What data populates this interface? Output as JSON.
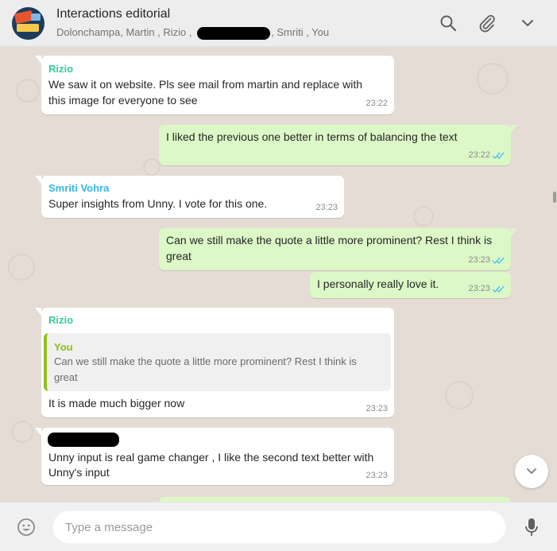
{
  "header": {
    "title": "Interactions editorial",
    "members_before": "Dolonchampa, Martin , Rizio ,",
    "members_after": ", Smriti , You",
    "icons": [
      "search-icon",
      "attach-icon",
      "chevron-down-icon"
    ]
  },
  "messages": [
    {
      "sender": "Rizio",
      "lines": [
        "We saw it on website. Pls see mail from martin and replace with",
        "this image for everyone to see"
      ],
      "time": "23:22"
    },
    {
      "lines": [
        "I liked the previous one better in terms of balancing the text"
      ],
      "time": "23:22"
    },
    {
      "sender": "Smriti Vohra",
      "lines": [
        "Super insights from Unny. I vote for this one."
      ],
      "time": "23:23"
    },
    {
      "lines": [
        "Can we still make the quote a little more prominent? Rest I think is",
        "great"
      ],
      "time": "23:23"
    },
    {
      "lines": [
        "I personally really love it."
      ],
      "time": "23:23"
    },
    {
      "sender": "Rizio",
      "quote": {
        "sender": "You",
        "lines": [
          "Can we still make the quote a little more prominent? Rest I think is",
          "great"
        ]
      },
      "lines": [
        "It is made much bigger now"
      ],
      "time": "23:23"
    },
    {
      "lines": [
        "Unny input is real game changer , I like the second text better with",
        "Unny's input"
      ],
      "time": "23:23"
    }
  ],
  "composer": {
    "placeholder": "Type a message"
  },
  "colors": {
    "header_bg": "#ededed",
    "chat_bg": "#e5ddd5",
    "outgoing_bubble": "#dcf8c6",
    "incoming_bubble": "#ffffff",
    "sender_rizio": "#35cd96",
    "sender_smriti": "#34b7f1",
    "quote_accent": "#8fbf1b",
    "read_ticks": "#4fc3f7"
  }
}
